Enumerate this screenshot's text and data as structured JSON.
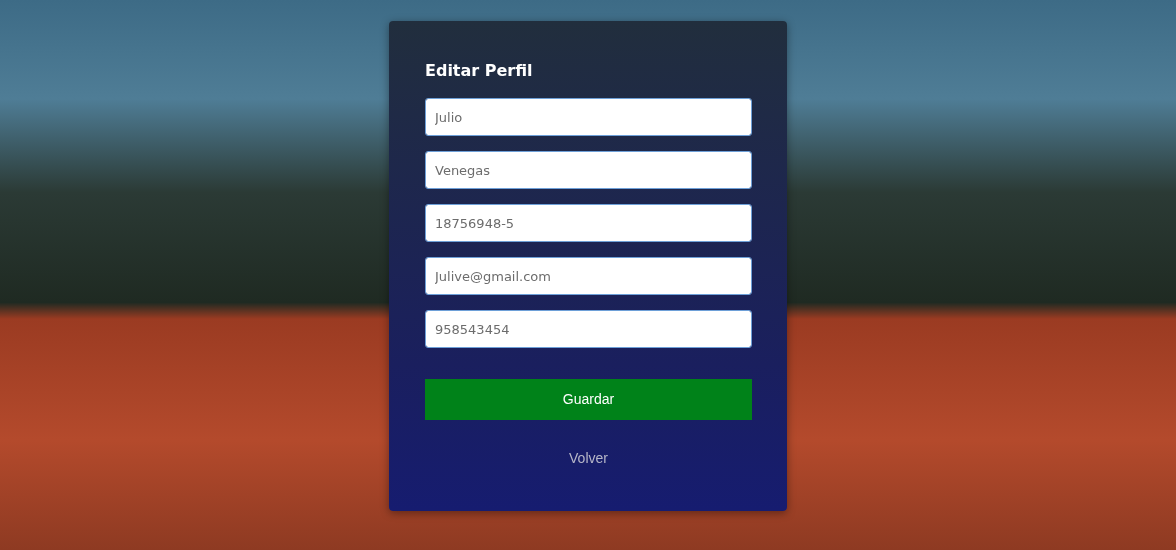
{
  "form": {
    "title": "Editar Perfil",
    "fields": [
      {
        "placeholder": "Julio"
      },
      {
        "placeholder": "Venegas"
      },
      {
        "placeholder": "18756948-5"
      },
      {
        "placeholder": "Julive@gmail.com"
      },
      {
        "placeholder": "958543454"
      }
    ],
    "submit_button": "Guardar",
    "back_link": "Volver"
  }
}
